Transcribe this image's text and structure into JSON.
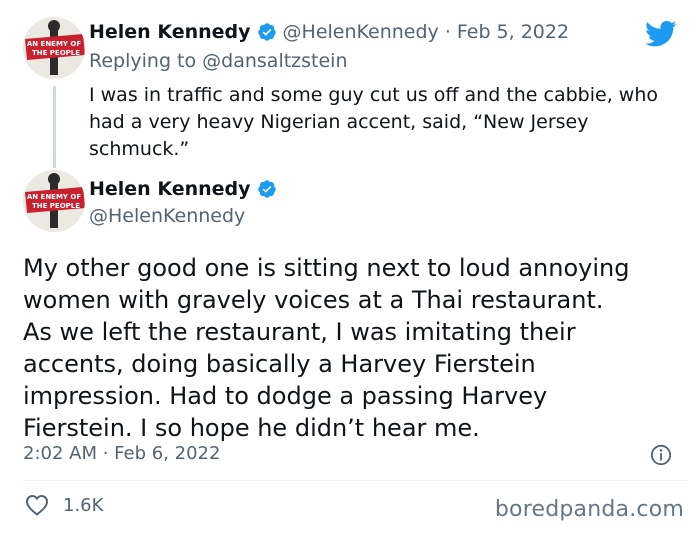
{
  "reply_tweet": {
    "author_name": "Helen Kennedy",
    "handle": "@HelenKennedy",
    "date": "Feb 5, 2022",
    "separator": "·",
    "replying_label": "Replying to ",
    "replying_to": "@dansaltzstein",
    "text_lines": [
      "I was in traffic and some guy cut us off and the cabbie, who",
      "had a very heavy Nigerian accent, said, “New Jersey",
      "schmuck.”"
    ]
  },
  "main_tweet": {
    "author_name": "Helen Kennedy",
    "handle": "@HelenKennedy",
    "text_lines": [
      "My other good one is sitting next to loud annoying",
      "women with gravely voices at a Thai restaurant.",
      "As we left the restaurant, I was imitating their",
      "accents, doing basically a Harvey Fierstein",
      "impression. Had to dodge a passing Harvey",
      "Fierstein. I so hope he didn’t hear me."
    ],
    "timestamp": "2:02 AM · Feb 6, 2022",
    "like_count": "1.6K"
  },
  "avatar": {
    "banner_text_line1": "AN ENEMY OF",
    "banner_text_line2": "THE PEOPLE"
  },
  "colors": {
    "verified_blue": "#1d9bf0",
    "twitter_blue": "#1d9bf0",
    "banner_red": "#c8202f",
    "muted_gray": "#536471"
  },
  "icons": {
    "brand": "twitter-bird-icon",
    "verified": "verified-badge-icon",
    "info": "info-icon",
    "like": "heart-icon"
  },
  "watermark": "boredpanda.com"
}
